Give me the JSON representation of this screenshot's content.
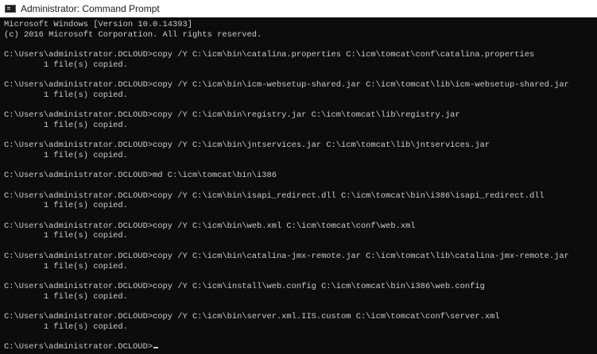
{
  "window": {
    "title": "Administrator: Command Prompt"
  },
  "console": {
    "lines": [
      "Microsoft Windows [Version 10.0.14393]",
      "(c) 2016 Microsoft Corporation. All rights reserved.",
      "",
      "C:\\Users\\administrator.DCLOUD>copy /Y C:\\icm\\bin\\catalina.properties C:\\icm\\tomcat\\conf\\catalina.properties",
      "        1 file(s) copied.",
      "",
      "C:\\Users\\administrator.DCLOUD>copy /Y C:\\icm\\bin\\icm-websetup-shared.jar C:\\icm\\tomcat\\lib\\icm-websetup-shared.jar",
      "        1 file(s) copied.",
      "",
      "C:\\Users\\administrator.DCLOUD>copy /Y C:\\icm\\bin\\registry.jar C:\\icm\\tomcat\\lib\\registry.jar",
      "        1 file(s) copied.",
      "",
      "C:\\Users\\administrator.DCLOUD>copy /Y C:\\icm\\bin\\jntservices.jar C:\\icm\\tomcat\\lib\\jntservices.jar",
      "        1 file(s) copied.",
      "",
      "C:\\Users\\administrator.DCLOUD>md C:\\icm\\tomcat\\bin\\i386",
      "",
      "C:\\Users\\administrator.DCLOUD>copy /Y C:\\icm\\bin\\isapi_redirect.dll C:\\icm\\tomcat\\bin\\i386\\isapi_redirect.dll",
      "        1 file(s) copied.",
      "",
      "C:\\Users\\administrator.DCLOUD>copy /Y C:\\icm\\bin\\web.xml C:\\icm\\tomcat\\conf\\web.xml",
      "        1 file(s) copied.",
      "",
      "C:\\Users\\administrator.DCLOUD>copy /Y C:\\icm\\bin\\catalina-jmx-remote.jar C:\\icm\\tomcat\\lib\\catalina-jmx-remote.jar",
      "        1 file(s) copied.",
      "",
      "C:\\Users\\administrator.DCLOUD>copy /Y C:\\icm\\install\\web.config C:\\icm\\tomcat\\bin\\i386\\web.config",
      "        1 file(s) copied.",
      "",
      "C:\\Users\\administrator.DCLOUD>copy /Y C:\\icm\\bin\\server.xml.IIS.custom C:\\icm\\tomcat\\conf\\server.xml",
      "        1 file(s) copied.",
      "",
      "C:\\Users\\administrator.DCLOUD>"
    ]
  },
  "icons": {
    "title": "cmd-icon",
    "cursor": "text-cursor"
  }
}
